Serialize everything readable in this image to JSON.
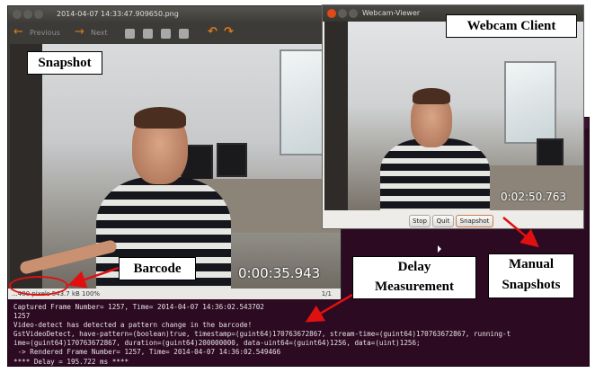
{
  "viewer": {
    "title": "2014-04-07 14:33:47.909650.png",
    "nav_prev": "Previous",
    "nav_next": "Next",
    "timestamp": "0:00:35.943",
    "status_left": "...480 pixels  543.7 kB  100%",
    "status_right": "1/1"
  },
  "webcam": {
    "title": "Webcam-Viewer",
    "timestamp": "0:02:50.763",
    "buttons": {
      "stop": "Stop",
      "quit": "Quit",
      "snapshot": "Snapshot"
    }
  },
  "terminal": {
    "lines": [
      "Captured Frame Number= 1257, Time= 2014-04-07 14:36:02.543702",
      "1257",
      "Video-detect has detected a pattern change in the barcode!",
      "GstVideoDetect, have-pattern=(boolean)true, timestamp=(guint64)170763672867, stream-time=(guint64)170763672867, running-t",
      "ime=(guint64)170763672867, duration=(guint64)200000000, data-uint64=(guint64)1256, data=(uint)1256;",
      " -> Rendered Frame Number= 1257, Time= 2014-04-07 14:36:02.549466",
      "**** Delay = 195.722 ms ****"
    ]
  },
  "annotations": {
    "snapshot": "Snapshot",
    "webcam_client": "Webcam Client",
    "barcode": "Barcode",
    "delay_line1": "Delay",
    "delay_line2": "Measurement",
    "manual_line1": "Manual",
    "manual_line2": "Snapshots"
  },
  "colors": {
    "arrow": "#e01010",
    "terminal_bg": "#2c0a22",
    "window_close": "#df4a16"
  }
}
